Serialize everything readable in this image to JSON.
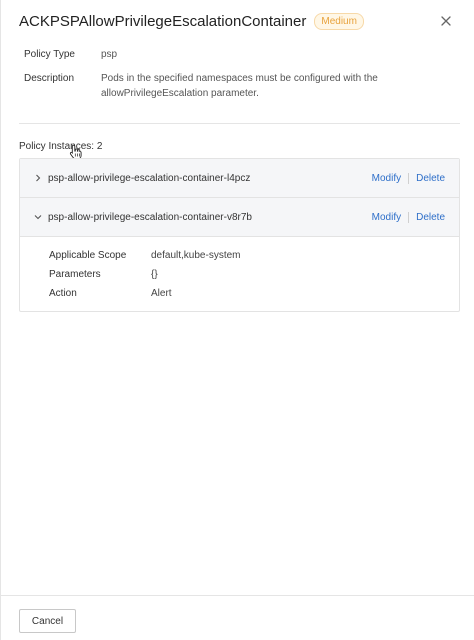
{
  "header": {
    "title": "ACKPSPAllowPrivilegeEscalationContainer",
    "severity": "Medium",
    "close_icon": "close-icon"
  },
  "policy_info": {
    "type_label": "Policy Type",
    "type_value": "psp",
    "description_label": "Description",
    "description_value": "Pods in the specified namespaces must be configured with the allowPrivilegeEscalation parameter."
  },
  "instances": {
    "label": "Policy Instances:",
    "count": "2",
    "items": [
      {
        "name": "psp-allow-privilege-escalation-container-l4pcz",
        "expanded": false,
        "modify_label": "Modify",
        "delete_label": "Delete"
      },
      {
        "name": "psp-allow-privilege-escalation-container-v8r7b",
        "expanded": true,
        "modify_label": "Modify",
        "delete_label": "Delete",
        "details": {
          "scope_label": "Applicable Scope",
          "scope_value": "default,kube-system",
          "parameters_label": "Parameters",
          "parameters_value": "{}",
          "action_label": "Action",
          "action_value": "Alert"
        }
      }
    ]
  },
  "footer": {
    "cancel_label": "Cancel"
  },
  "colors": {
    "link": "#2e6fc9",
    "badge_text": "#e8a23c",
    "row_background": "#f5f6f8"
  }
}
